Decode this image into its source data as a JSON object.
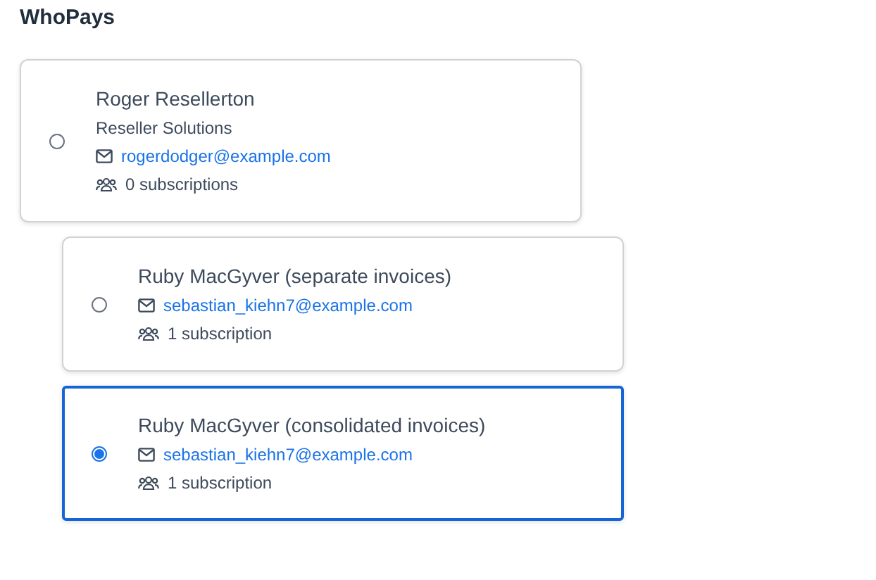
{
  "title": "WhoPays",
  "options": [
    {
      "name": "Roger Resellerton",
      "company": "Reseller Solutions",
      "email": "rogerdodger@example.com",
      "subscriptions": "0 subscriptions",
      "selected": false,
      "children": [
        {
          "name": "Ruby MacGyver (separate invoices)",
          "email": "sebastian_kiehn7@example.com",
          "subscriptions": "1 subscription",
          "selected": false
        },
        {
          "name": "Ruby MacGyver (consolidated invoices)",
          "email": "sebastian_kiehn7@example.com",
          "subscriptions": "1 subscription",
          "selected": true
        }
      ]
    }
  ]
}
